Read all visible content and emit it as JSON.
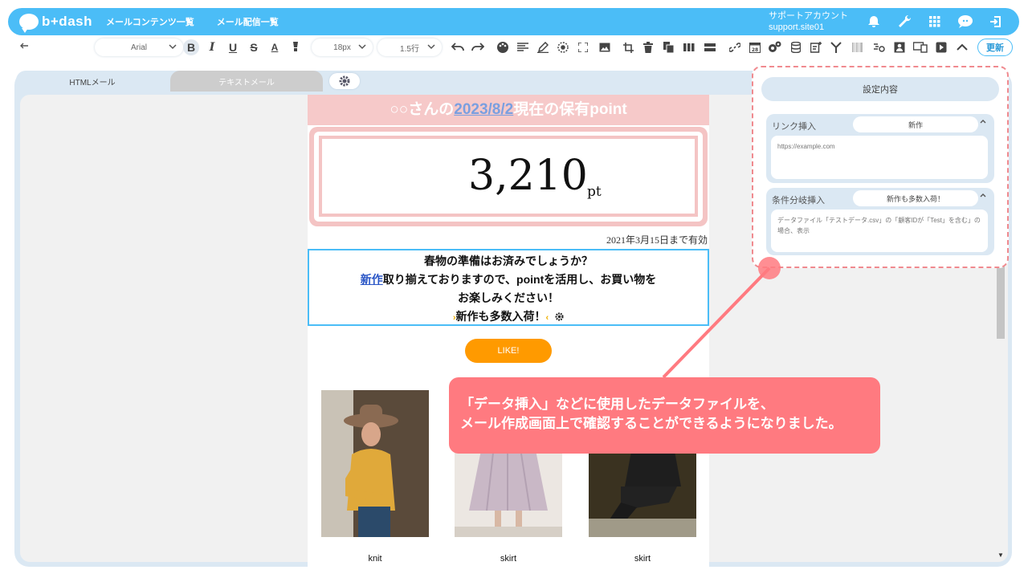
{
  "header": {
    "logo_text": "b+dash",
    "nav": [
      "メールコンテンツ一覧",
      "メール配信一覧"
    ],
    "account_label": "サポートアカウント",
    "account_site": "support.site01"
  },
  "toolbar": {
    "font_family": "Arial",
    "font_size": "18px",
    "line_height": "1.5行",
    "update_label": "更新"
  },
  "tabs": {
    "html_label": "HTMLメール",
    "text_label": "テキストメール"
  },
  "email": {
    "head_prefix": "○○さんの",
    "head_date": "2023/8/2",
    "head_suffix": "現在の保有point",
    "point_value": "3,210",
    "point_unit": "pt",
    "valid_until": "2021年3月15日まで有効",
    "msg_line1": "春物の準備はお済みでしょうか？",
    "msg_link": "新作",
    "msg_line2_rest": "取り揃えておりますので、pointを活用し、お買い物を",
    "msg_line3": "お楽しみください！",
    "msg_tag": "新作も多数入荷！",
    "like_label": "LIKE!",
    "products": [
      {
        "label": "knit"
      },
      {
        "label": "skirt"
      },
      {
        "label": "skirt"
      }
    ]
  },
  "panel": {
    "title": "設定内容",
    "link_label": "リンク挿入",
    "link_value": "新作",
    "link_placeholder": "https://example.com",
    "cond_label": "条件分岐挿入",
    "cond_value": "新作も多数入荷！",
    "cond_text": "データファイル「テストデータ.csv」の「顧客IDが「Test」を含む」の場合、表示"
  },
  "callout": {
    "line1": "「データ挿入」などに使用したデータファイルを、",
    "line2": "メール作成画面上で確認することができるようになりました。"
  },
  "colors": {
    "brand": "#4bbdf7",
    "pink": "#f4c4c4",
    "callout": "#ff7a80",
    "like": "#ff9a00"
  }
}
